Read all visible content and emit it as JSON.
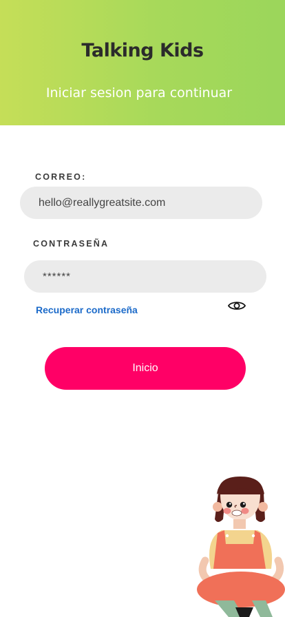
{
  "header": {
    "title": "Talking Kids",
    "subtitle": "Iniciar sesion para continuar"
  },
  "form": {
    "email_label": "CORREO:",
    "email_value": "hello@reallygreatsite.com",
    "password_label": "CONTRASEÑA",
    "password_value": "******",
    "recover_link": "Recuperar contraseña",
    "submit_label": "Inicio"
  },
  "icons": {
    "password_toggle": "eye-icon",
    "illustration": "girl-illustration"
  },
  "colors": {
    "header_gradient_start": "#c5de58",
    "header_gradient_end": "#9bd65b",
    "primary_button": "#ff0066",
    "link": "#1b6ac9",
    "field_background": "#ebebeb"
  }
}
